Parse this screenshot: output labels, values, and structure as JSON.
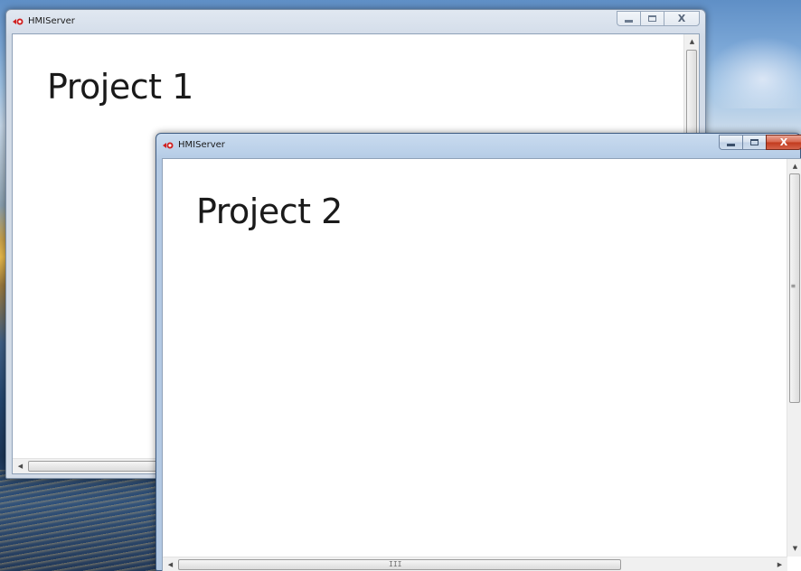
{
  "windows": [
    {
      "title": "HMIServer",
      "content_label": "Project 1",
      "state": "inactive",
      "buttons": {
        "minimize": "minimize",
        "maximize": "maximize",
        "close": "X"
      }
    },
    {
      "title": "HMIServer",
      "content_label": "Project 2",
      "state": "active",
      "buttons": {
        "minimize": "minimize",
        "maximize": "maximize",
        "close": "X"
      }
    }
  ],
  "scrollbar_glyphs": {
    "up": "▲",
    "down": "▼",
    "left": "◀",
    "right": "▶",
    "grip_h": "III",
    "grip_v": "≡"
  },
  "colors": {
    "active_close": "#c2391c",
    "title_bar_active": "#b9cfe8",
    "title_bar_inactive": "#d6dfeb"
  },
  "icons": {
    "app": "hmi-server-app-icon",
    "minimize": "minimize-icon",
    "maximize": "maximize-icon",
    "close": "close-icon"
  }
}
